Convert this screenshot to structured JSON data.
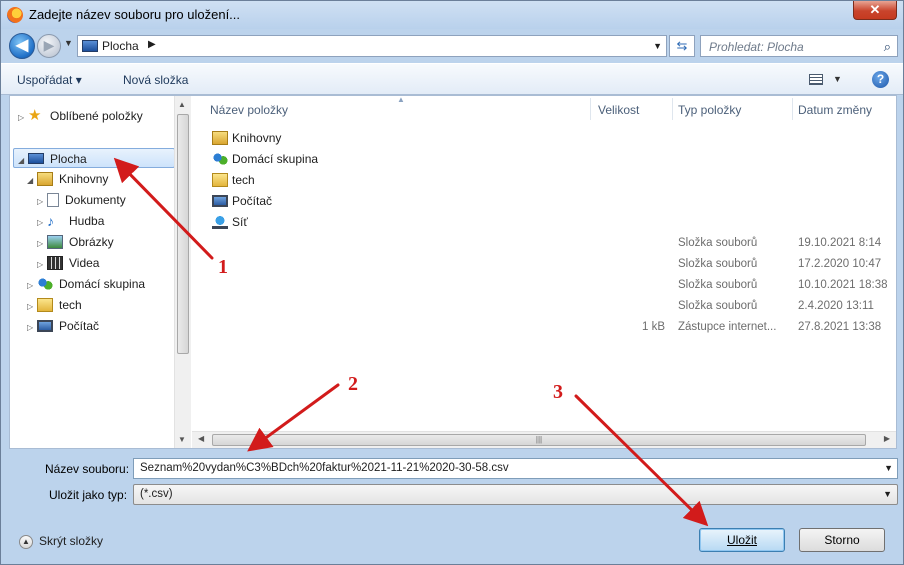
{
  "window": {
    "title": "Zadejte název souboru pro uložení...",
    "close_glyph": "✕"
  },
  "navbar": {
    "back_glyph": "◀",
    "forward_glyph": "▶",
    "address": "Plocha",
    "address_separator": "▶",
    "search_placeholder": "Prohledat: Plocha"
  },
  "toolbar": {
    "organize_label": "Uspořádat ▾",
    "new_folder_label": "Nová složka",
    "help_glyph": "?"
  },
  "nav_tree": [
    {
      "label": "Oblíbené položky",
      "icon": "star-icon",
      "arrow": "▷"
    },
    {
      "label": "Plocha",
      "icon": "desktop-icon",
      "arrow": "◢",
      "selected": true
    },
    {
      "label": "Knihovny",
      "icon": "libraries-icon",
      "arrow": "◢"
    },
    {
      "label": "Dokumenty",
      "icon": "documents-icon",
      "arrow": "▷"
    },
    {
      "label": "Hudba",
      "icon": "music-icon",
      "arrow": "▷"
    },
    {
      "label": "Obrázky",
      "icon": "pictures-icon",
      "arrow": "▷"
    },
    {
      "label": "Videa",
      "icon": "videos-icon",
      "arrow": "▷"
    },
    {
      "label": "Domácí skupina",
      "icon": "homegroup-icon",
      "arrow": "▷"
    },
    {
      "label": "tech",
      "icon": "user-folder-icon",
      "arrow": "▷"
    },
    {
      "label": "Počítač",
      "icon": "computer-icon",
      "arrow": "▷"
    }
  ],
  "file_columns": {
    "name": "Název položky",
    "size": "Velikost",
    "type": "Typ položky",
    "date": "Datum změny"
  },
  "files": [
    {
      "name": "Knihovny",
      "icon": "libraries-icon"
    },
    {
      "name": "Domácí skupina",
      "icon": "homegroup-icon"
    },
    {
      "name": "tech",
      "icon": "user-folder-icon"
    },
    {
      "name": "Počítač",
      "icon": "computer-icon"
    },
    {
      "name": "Síť",
      "icon": "network-icon"
    }
  ],
  "hidden_rows": [
    {
      "size": "",
      "type": "Složka souborů",
      "date": "19.10.2021 8:14"
    },
    {
      "size": "",
      "type": "Složka souborů",
      "date": "17.2.2020 10:47"
    },
    {
      "size": "",
      "type": "Složka souborů",
      "date": "10.10.2021 18:38"
    },
    {
      "size": "",
      "type": "Složka souborů",
      "date": "2.4.2020 13:11"
    },
    {
      "size": "1 kB",
      "type": "Zástupce internet...",
      "date": "27.8.2021 13:38"
    }
  ],
  "form": {
    "filename_label": "Název souboru:",
    "filename_value": "Seznam%20vydan%C3%BDch%20faktur%2021-11-21%2020-30-58.csv",
    "filetype_label": "Uložit jako typ:",
    "filetype_value": "(*.csv)"
  },
  "footer": {
    "hide_folders_label": "Skrýt složky",
    "save_label": "Uložit",
    "cancel_label": "Storno"
  },
  "annotations": {
    "color": "#d21b1b",
    "labels": [
      "1",
      "2",
      "3"
    ]
  }
}
